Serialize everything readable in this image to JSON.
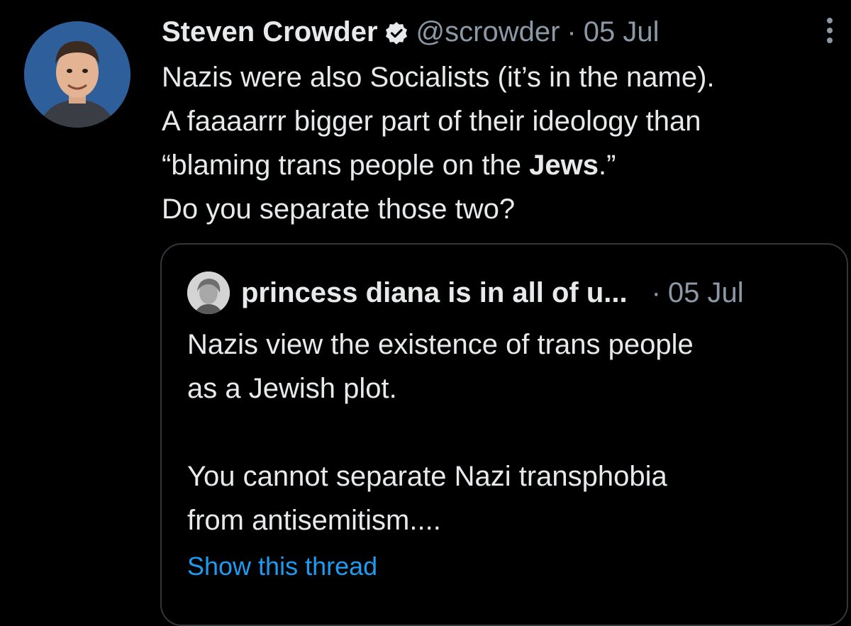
{
  "tweet": {
    "author_name": "Steven Crowder",
    "verified_icon": "verified-badge-icon",
    "handle": "@scrowder",
    "separator": "·",
    "date": "05 Jul",
    "more_icon": "more-vertical-icon",
    "text_lines": [
      "Nazis were also Socialists (it’s in the name).",
      "A faaaarrr bigger part of their ideology than",
      "“blaming trans people on the ",
      "Do you separate those two?"
    ],
    "bold_word": "Jews",
    "after_bold": ".”"
  },
  "quoted": {
    "author_name": "princess diana is in all of u...",
    "separator": "·",
    "date": "05 Jul",
    "text_lines": [
      "Nazis view the existence of trans people",
      "as a Jewish plot.",
      "",
      "You cannot separate Nazi transphobia",
      "from antisemitism...."
    ],
    "show_thread": "Show this thread"
  },
  "colors": {
    "background": "#000000",
    "text": "#e7e9ea",
    "secondary": "#8b98a5",
    "link": "#1d9bf0",
    "border": "#333639"
  }
}
